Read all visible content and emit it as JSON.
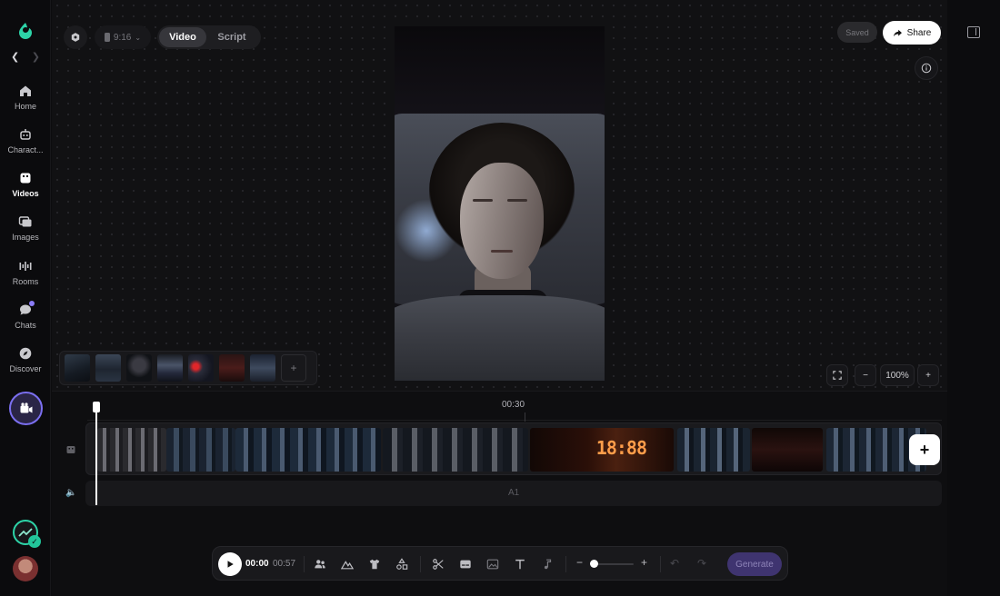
{
  "sidebar": {
    "items": [
      {
        "label": "Home",
        "icon": "home-icon"
      },
      {
        "label": "Charact...",
        "icon": "robot-icon"
      },
      {
        "label": "Videos",
        "icon": "video-icon",
        "active": true
      },
      {
        "label": "Images",
        "icon": "images-icon"
      },
      {
        "label": "Rooms",
        "icon": "rooms-icon"
      },
      {
        "label": "Chats",
        "icon": "chat-icon"
      },
      {
        "label": "Discover",
        "icon": "compass-icon"
      }
    ]
  },
  "header": {
    "aspect_ratio": "9:16",
    "modes": [
      "Video",
      "Script"
    ],
    "active_mode": "Video",
    "saved_label": "Saved",
    "share_label": "Share"
  },
  "preview": {
    "zoom_level": "100%"
  },
  "timeline": {
    "ruler_label": "00:30",
    "audio_track_label": "A1"
  },
  "playback": {
    "current_time": "00:00",
    "total_time": "00:57",
    "generate_label": "Generate"
  },
  "colors": {
    "accent": "#7b6ff0",
    "brand_green": "#2dd4a8",
    "background": "#111113"
  }
}
